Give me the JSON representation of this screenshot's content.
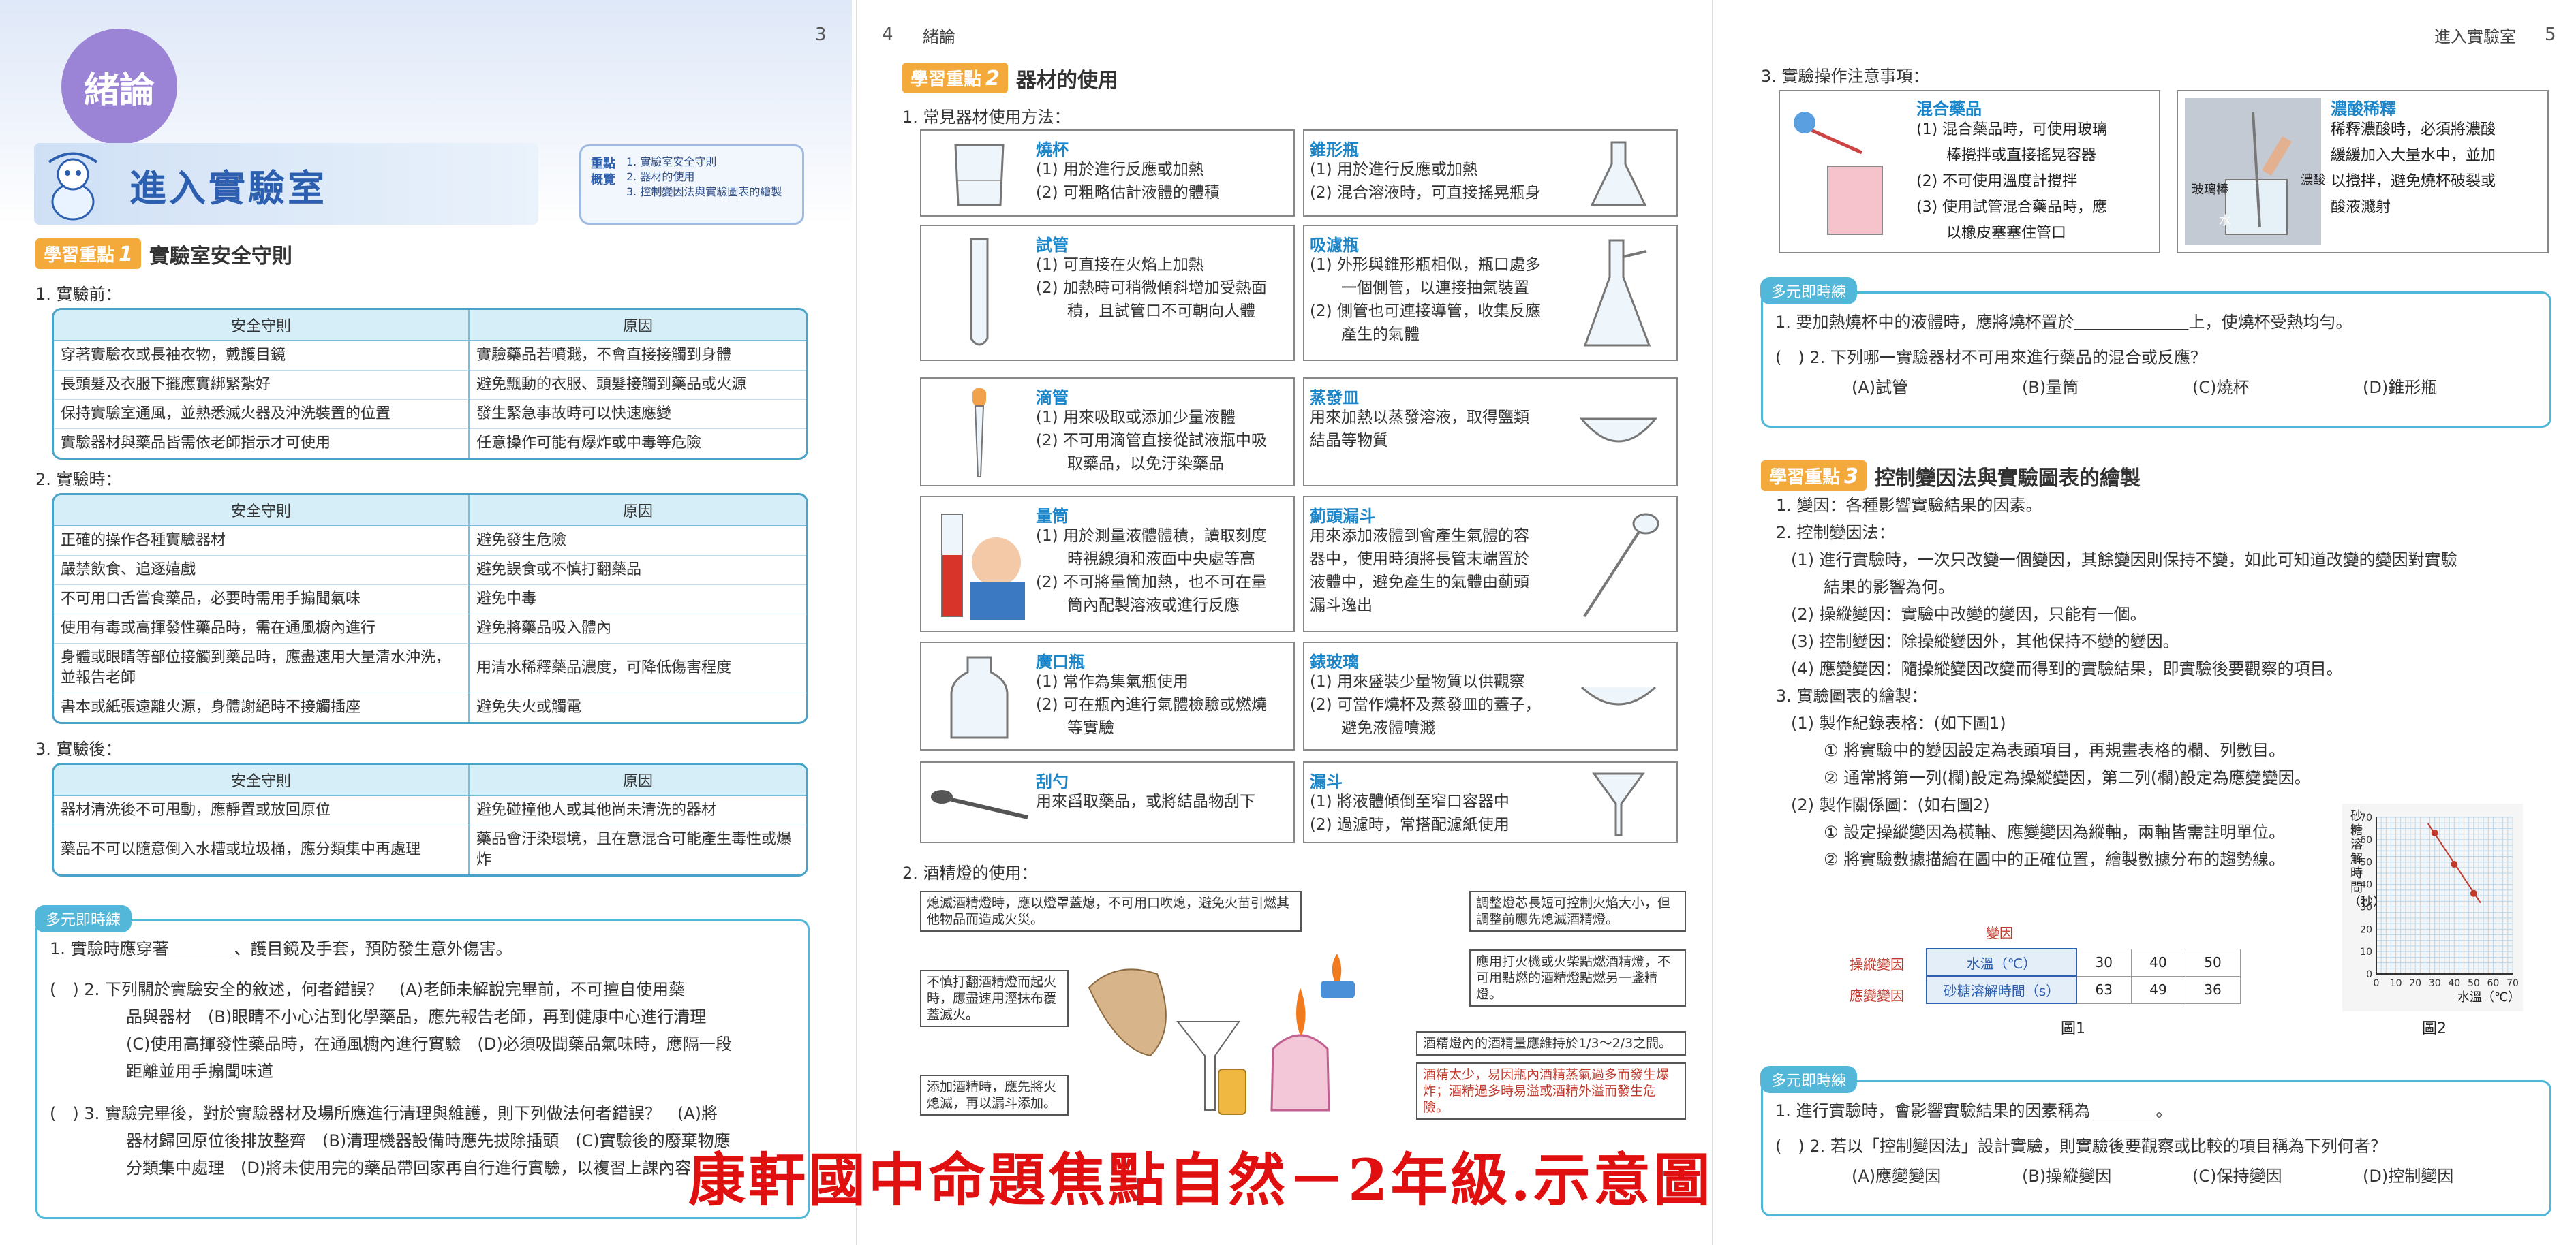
{
  "page3": {
    "page_number": "3",
    "chapter": "緒論",
    "title": "進入實驗室",
    "focus_label": "重點概覽",
    "focus_items": [
      "1. 實驗室安全守則",
      "2. 器材的使用",
      "3. 控制變因法與實驗圖表的繪製"
    ],
    "section1": {
      "badge": "學習重點",
      "num": "1",
      "title": "實驗室安全守則"
    },
    "before": {
      "heading": "1. 實驗前：",
      "col1": "安全守則",
      "col2": "原因",
      "rows": [
        [
          "穿著實驗衣或長袖衣物，戴護目鏡",
          "實驗藥品若噴濺，不會直接接觸到身體"
        ],
        [
          "長頭髮及衣服下擺應實綁緊紮好",
          "避免飄動的衣服、頭髮接觸到藥品或火源"
        ],
        [
          "保持實驗室通風，並熟悉滅火器及沖洗裝置的位置",
          "發生緊急事故時可以快速應變"
        ],
        [
          "實驗器材與藥品皆需依老師指示才可使用",
          "任意操作可能有爆炸或中毒等危險"
        ]
      ]
    },
    "during": {
      "heading": "2. 實驗時：",
      "col1": "安全守則",
      "col2": "原因",
      "rows": [
        [
          "正確的操作各種實驗器材",
          "避免發生危險"
        ],
        [
          "嚴禁飲食、追逐嬉戲",
          "避免誤食或不慎打翻藥品"
        ],
        [
          "不可用口舌嘗食藥品，必要時需用手搧聞氣味",
          "避免中毒"
        ],
        [
          "使用有毒或高揮發性藥品時，需在通風櫥內進行",
          "避免將藥品吸入體內"
        ],
        [
          "身體或眼睛等部位接觸到藥品時，應盡速用大量清水沖洗，並報告老師",
          "用清水稀釋藥品濃度，可降低傷害程度"
        ],
        [
          "書本或紙張遠離火源，身體謝絕時不接觸插座",
          "避免失火或觸電"
        ]
      ]
    },
    "after": {
      "heading": "3. 實驗後：",
      "col1": "安全守則",
      "col2": "原因",
      "rows": [
        [
          "器材清洗後不可甩動，應靜置或放回原位",
          "避免碰撞他人或其他尚未清洗的器材"
        ],
        [
          "藥品不可以隨意倒入水槽或垃圾桶，應分類集中再處理",
          "藥品會汙染環境，且在意混合可能產生毒性或爆炸"
        ]
      ]
    },
    "quiz": {
      "tag": "多元即時練",
      "q1": "1. 實驗時應穿著＿＿＿＿、護目鏡及手套，預防發生意外傷害。",
      "q2_lines": [
        "(　) 2. 下列關於實驗安全的敘述，何者錯誤？　(A)老師未解說完畢前，不可擅自使用藥",
        "品與器材　(B)眼睛不小心沾到化學藥品，應先報告老師，再到健康中心進行清理",
        "(C)使用高揮發性藥品時，在通風櫥內進行實驗　(D)必須吸聞藥品氣味時，應隔一段",
        "距離並用手搧聞味道"
      ],
      "q3_lines": [
        "(　) 3. 實驗完畢後，對於實驗器材及場所應進行清理與維護，則下列做法何者錯誤？　(A)將",
        "器材歸回原位後排放整齊　(B)清理機器設備時應先拔除插頭　(C)實驗後的廢棄物應",
        "分類集中處理　(D)將未使用完的藥品帶回家再自行進行實驗，以複習上課內容"
      ]
    }
  },
  "page4": {
    "page_number": "4",
    "header": "緒論",
    "section2": {
      "badge": "學習重點",
      "num": "2",
      "title": "器材的使用"
    },
    "sub1": "1. 常見器材使用方法：",
    "equipment": [
      {
        "name": "燒杯",
        "lines": [
          "(1) 用於進行反應或加熱",
          "(2) 可粗略估計液體的體積"
        ]
      },
      {
        "name": "錐形瓶",
        "lines": [
          "(1) 用於進行反應或加熱",
          "(2) 混合溶液時，可直接搖晃瓶身"
        ]
      },
      {
        "name": "試管",
        "lines": [
          "(1) 可直接在火焰上加熱",
          "(2) 加熱時可稍微傾斜增加受熱面",
          "　　積，且試管口不可朝向人體"
        ]
      },
      {
        "name": "吸濾瓶",
        "lines": [
          "(1) 外形與錐形瓶相似，瓶口處多",
          "　　一個側管，以連接抽氣裝置",
          "(2) 側管也可連接導管，收集反應",
          "　　產生的氣體"
        ]
      },
      {
        "name": "滴管",
        "lines": [
          "(1) 用來吸取或添加少量液體",
          "(2) 不可用滴管直接從試液瓶中吸",
          "　　取藥品，以免汙染藥品"
        ]
      },
      {
        "name": "蒸發皿",
        "lines": [
          "用來加熱以蒸發溶液，取得鹽類",
          "結晶等物質"
        ]
      },
      {
        "name": "量筒",
        "lines": [
          "(1) 用於測量液體體積，讀取刻度",
          "　　時視線須和液面中央處等高",
          "(2) 不可將量筒加熱，也不可在量",
          "　　筒內配製溶液或進行反應"
        ]
      },
      {
        "name": "薊頭漏斗",
        "lines": [
          "用來添加液體到會產生氣體的容",
          "器中，使用時須將長管末端置於",
          "液體中，避免產生的氣體由薊頭",
          "漏斗逸出"
        ]
      },
      {
        "name": "廣口瓶",
        "lines": [
          "(1) 常作為集氣瓶使用",
          "(2) 可在瓶內進行氣體檢驗或燃燒",
          "　　等實驗"
        ]
      },
      {
        "name": "錶玻璃",
        "lines": [
          "(1) 用來盛裝少量物質以供觀察",
          "(2) 可當作燒杯及蒸發皿的蓋子，",
          "　　避免液體噴濺"
        ]
      },
      {
        "name": "刮勺",
        "lines": [
          "用來舀取藥品，或將結晶物刮下"
        ]
      },
      {
        "name": "漏斗",
        "lines": [
          "(1) 將液體傾倒至窄口容器中",
          "(2) 過濾時，常搭配濾紙使用"
        ]
      }
    ],
    "sub2": "2. 酒精燈的使用：",
    "callouts": [
      "熄滅酒精燈時，應以燈罩蓋熄，不可用口吹熄，避免火苗引燃其他物品而造成火災。",
      "調整燈芯長短可控制火焰大小，但調整前應先熄滅酒精燈。",
      "不慎打翻酒精燈而起火時，應盡速用溼抹布覆蓋滅火。",
      "應用打火機或火柴點燃酒精燈，不可用點燃的酒精燈點燃另一盞精燈。",
      "添加酒精時，應先將火熄滅，再以漏斗添加。",
      "酒精燈內的酒精量應維持於1/3～2/3之間。",
      "酒精太少，易因瓶內酒精蒸氣過多而發生爆炸；酒精過多時易溢或酒精外溢而發生危險。"
    ],
    "watermark": "康軒國中命題焦點自然－2年級.示意圖"
  },
  "page5": {
    "page_number": "5",
    "header": "進入實驗室",
    "sub3": "3. 實驗操作注意事項：",
    "mix": {
      "title": "混合藥品",
      "lines": [
        "(1) 混合藥品時，可使用玻璃",
        "　　棒攪拌或直接搖晃容器",
        "(2) 不可使用溫度計攪拌",
        "(3) 使用試管混合藥品時，應",
        "　　以橡皮塞塞住管口"
      ]
    },
    "acid": {
      "title": "濃酸稀釋",
      "lines": [
        "稀釋濃酸時，必須將濃酸",
        "緩緩加入大量水中，並加",
        "以攪拌，避免燒杯破裂或",
        "酸液濺射"
      ],
      "lbl_rod": "玻璃棒",
      "lbl_water": "水",
      "lbl_acid": "濃酸"
    },
    "quiz1": {
      "tag": "多元即時練",
      "q1": "1. 要加熱燒杯中的液體時，應將燒杯置於＿＿＿＿＿＿＿上，使燒杯受熱均勻。",
      "q2": "(　) 2. 下列哪一實驗器材不可用來進行藥品的混合或反應？",
      "opts": [
        "(A)試管",
        "(B)量筒",
        "(C)燒杯",
        "(D)錐形瓶"
      ]
    },
    "section3": {
      "badge": "學習重點",
      "num": "3",
      "title": "控制變因法與實驗圖表的繪製"
    },
    "items": [
      "1. 變因：各種影響實驗結果的因素。",
      "2. 控制變因法：",
      "(1) 進行實驗時，一次只改變一個變因，其餘變因則保持不變，如此可知道改變的變因對實驗",
      "　　結果的影響為何。",
      "(2) 操縱變因：實驗中改變的變因，只能有一個。",
      "(3) 控制變因：除操縱變因外，其他保持不變的變因。",
      "(4) 應變變因：隨操縱變因改變而得到的實驗結果，即實驗後要觀察的項目。",
      "3. 實驗圖表的繪製：",
      "(1) 製作紀錄表格：(如下圖1)",
      "　　① 將實驗中的變因設定為表頭項目，再規畫表格的欄、列數目。",
      "　　② 通常將第一列(欄)設定為操縱變因，第二列(欄)設定為應變變因。",
      "(2) 製作關係圖：(如右圖2)",
      "　　① 設定操縱變因為橫軸、應變變因為縱軸，兩軸皆需註明單位。",
      "　　② 將實驗數據描繪在圖中的正確位置，繪製數據分布的趨勢線。"
    ],
    "table1": {
      "label_var": "變因",
      "row1_label": "操縱變因",
      "row2_label": "應變變因",
      "row1_head": "水溫（℃）",
      "row2_head": "砂糖溶解時間（s）",
      "row1": [
        "30",
        "40",
        "50"
      ],
      "row2": [
        "63",
        "49",
        "36"
      ],
      "caption": "圖1"
    },
    "graph": {
      "ylabel": "砂糖溶解時間（秒）",
      "xlabel": "水溫（℃）",
      "caption": "圖2"
    },
    "quiz2": {
      "tag": "多元即時練",
      "q1": "1. 進行實驗時，會影響實驗結果的因素稱為＿＿＿＿。",
      "q2": "(　) 2. 若以「控制變因法」設計實驗，則實驗後要觀察或比較的項目稱為下列何者？",
      "opts": [
        "(A)應變變因",
        "(B)操縱變因",
        "(C)保持變因",
        "(D)控制變因"
      ]
    }
  },
  "chart_data": {
    "type": "scatter",
    "title": "",
    "xlabel": "水溫（℃）",
    "ylabel": "砂糖溶解時間（秒）",
    "x": [
      30,
      40,
      50
    ],
    "y": [
      63,
      49,
      36
    ],
    "xlim": [
      0,
      70
    ],
    "ylim": [
      0,
      70
    ],
    "xticks": [
      0,
      10,
      20,
      30,
      40,
      50,
      60,
      70
    ],
    "yticks": [
      0,
      10,
      20,
      30,
      40,
      50,
      60,
      70
    ],
    "grid": true
  }
}
